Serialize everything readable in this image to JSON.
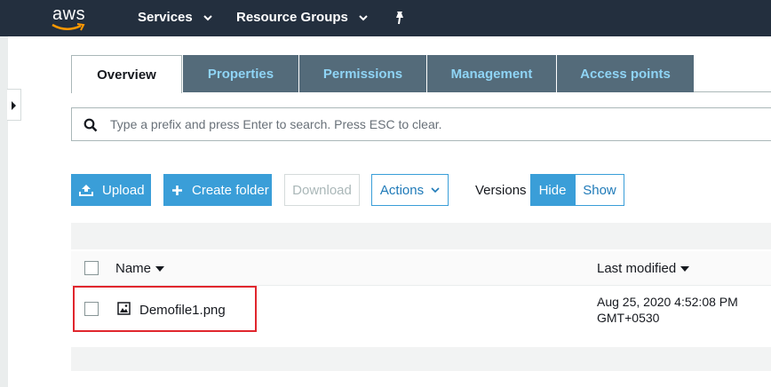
{
  "topbar": {
    "logo_text": "aws",
    "services_label": "Services",
    "resource_groups_label": "Resource Groups"
  },
  "tabs": [
    {
      "label": "Overview",
      "active": true
    },
    {
      "label": "Properties",
      "active": false
    },
    {
      "label": "Permissions",
      "active": false
    },
    {
      "label": "Management",
      "active": false
    },
    {
      "label": "Access points",
      "active": false
    }
  ],
  "search": {
    "placeholder": "Type a prefix and press Enter to search. Press ESC to clear.",
    "value": ""
  },
  "toolbar": {
    "upload_label": "Upload",
    "create_folder_label": "Create folder",
    "download_label": "Download",
    "actions_label": "Actions",
    "versions_label": "Versions",
    "hide_label": "Hide",
    "show_label": "Show"
  },
  "table": {
    "columns": {
      "name": "Name",
      "last_modified": "Last modified"
    },
    "rows": [
      {
        "name": "Demofile1.png",
        "last_modified_line1": "Aug 25, 2020 4:52:08 PM",
        "last_modified_line2": "GMT+0530"
      }
    ]
  },
  "colors": {
    "nav_bg": "#232f3e",
    "tab_bg": "#546b7a",
    "tab_text": "#8fd4f5",
    "primary": "#3a9ed8",
    "highlight": "#e0262d"
  },
  "icons": [
    "aws-smile-icon",
    "chevron-down-icon",
    "pin-icon",
    "search-icon",
    "upload-icon",
    "plus-icon",
    "image-file-icon",
    "sort-down-icon",
    "expand-panel-icon"
  ]
}
